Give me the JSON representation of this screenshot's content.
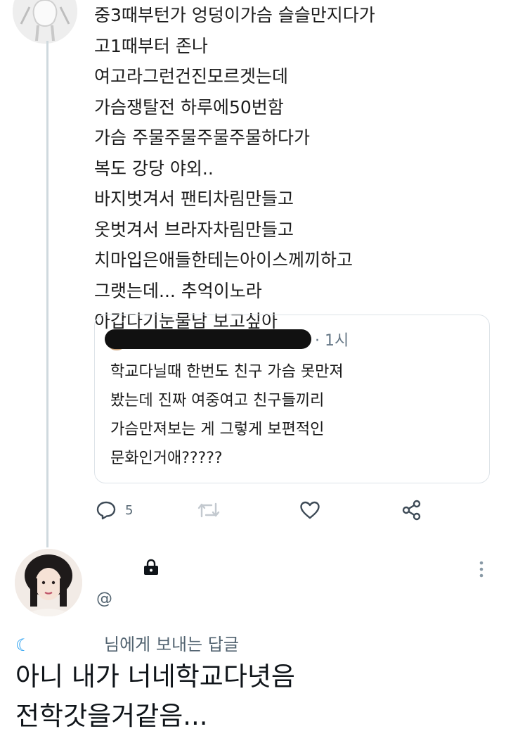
{
  "tweet": {
    "lines": [
      "중3때부턴가 엉덩이가슴 슬슬만지다가",
      "고1때부터 존나",
      "여고라그런건진모르겟는데",
      "가슴쟁탈전 하루에50번함",
      "가슴 주물주물주물주물하다가",
      "복도 강당 야외..",
      "바지벗겨서 팬티차림만들고",
      "옷벗겨서 브라자차림만들고",
      "치마입은애들한테는아이스께끼하고",
      "그랫는데... 추억이노라",
      "아갑다기눈물남 보고싶아"
    ]
  },
  "quote": {
    "time": "· 1시",
    "lines": [
      "학교다닐때 한번도 친구 가슴 못만져",
      "봤는데 진짜 여중여고 친구들끼리",
      "가슴만져보는 게 그렇게 보편적인",
      "문화인거애?????"
    ]
  },
  "actions": {
    "reply_count": "5",
    "icons": [
      "reply-icon",
      "retweet-icon",
      "like-icon",
      "share-icon"
    ]
  },
  "reply": {
    "handle": "@",
    "replying_to": "님에게 보내는 답글",
    "lines": [
      "아니 내가 너네학교다녓음",
      "전학갓을거같음..."
    ]
  },
  "colors": {
    "accent": "#1d9bf0",
    "secondary_text": "#536471",
    "icon_gray": "#3d4a56",
    "retweet_gray": "#c3c9cf"
  }
}
